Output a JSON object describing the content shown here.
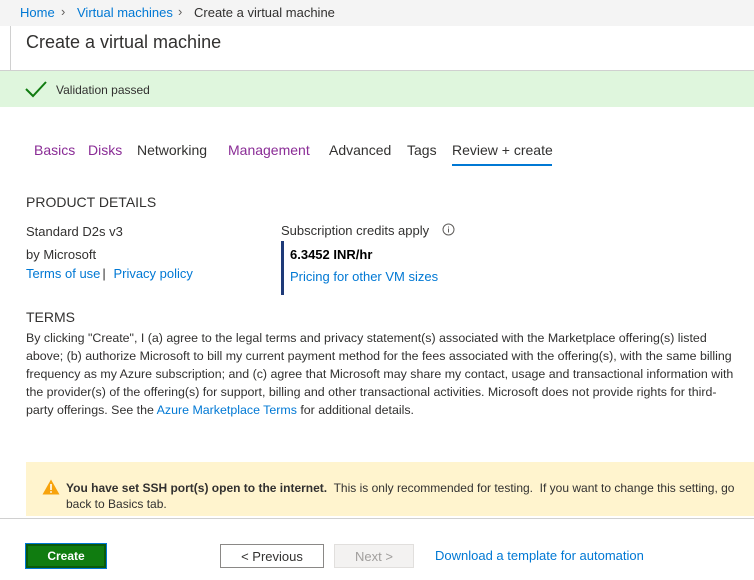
{
  "breadcrumb": {
    "items": [
      "Home",
      "Virtual machines"
    ],
    "current": "Create a virtual machine"
  },
  "page_title": "Create a virtual machine",
  "validation": {
    "message": "Validation passed",
    "icon": "checkmark-icon",
    "color": "#dff6dd"
  },
  "tabs": [
    {
      "label": "Basics",
      "state": "visited"
    },
    {
      "label": "Disks",
      "state": "visited"
    },
    {
      "label": "Networking",
      "state": "default"
    },
    {
      "label": "Management",
      "state": "visited"
    },
    {
      "label": "Advanced",
      "state": "default"
    },
    {
      "label": "Tags",
      "state": "default"
    },
    {
      "label": "Review + create",
      "state": "active"
    }
  ],
  "product": {
    "heading": "PRODUCT DETAILS",
    "name": "Standard D2s v3",
    "publisher": "by Microsoft",
    "terms_link": "Terms of use",
    "separator": "|",
    "privacy_link": "Privacy policy",
    "credits_label": "Subscription credits apply",
    "price": "6.3452 INR/hr",
    "pricing_link": "Pricing for other VM sizes"
  },
  "terms": {
    "heading": "TERMS",
    "text_before_link": "By clicking \"Create\", I (a) agree to the legal terms and privacy statement(s) associated with the Marketplace offering(s) listed above; (b) authorize Microsoft to bill my current payment method for the fees associated with the offering(s), with the same billing frequency as my Azure subscription; and (c) agree that Microsoft may share my contact, usage and transactional information with the provider(s) of the offering(s) for support, billing and other transactional activities. Microsoft does not provide rights for third-party offerings. See the ",
    "link": "Azure Marketplace Terms",
    "text_after_link": " for additional details."
  },
  "warning": {
    "bold": "You have set SSH port(s) open to the internet.",
    "text": "  This is only recommended for testing.  If you want to change this setting, go back to Basics tab.",
    "icon": "warning-icon",
    "color": "#fff4ce"
  },
  "footer": {
    "create_label": "Create",
    "previous_label": "< Previous",
    "next_label": "Next >",
    "download_link": "Download a template for automation"
  },
  "colors": {
    "accent": "#0078d4",
    "visited_tab": "#8a2c96",
    "create_button": "#107c10"
  }
}
